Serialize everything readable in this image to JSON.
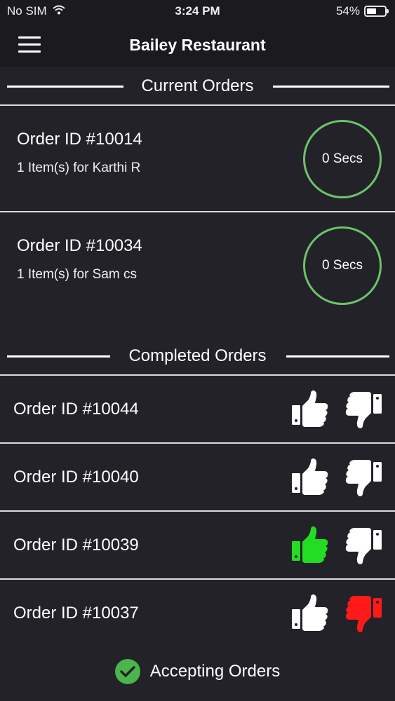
{
  "status_bar": {
    "carrier": "No SIM",
    "time": "3:24 PM",
    "battery_text": "54%",
    "battery_level": 0.54
  },
  "nav": {
    "title": "Bailey Restaurant",
    "menu_icon": "hamburger-icon"
  },
  "sections": {
    "current_title": "Current Orders",
    "completed_title": "Completed Orders"
  },
  "current_orders": [
    {
      "order_id": "Order ID #10014",
      "summary": "1 Item(s) for Karthi R",
      "timer": "0 Secs"
    },
    {
      "order_id": "Order ID #10034",
      "summary": "1 Item(s) for Sam cs",
      "timer": "0 Secs"
    }
  ],
  "completed_orders": [
    {
      "order_id": "Order ID #10044",
      "rating": "none"
    },
    {
      "order_id": "Order ID #10040",
      "rating": "none"
    },
    {
      "order_id": "Order ID #10039",
      "rating": "up"
    },
    {
      "order_id": "Order ID #10037",
      "rating": "down"
    }
  ],
  "footer": {
    "status_label": "Accepting Orders",
    "status_icon": "checkmark-circle-icon"
  },
  "colors": {
    "background": "#222228",
    "bar": "#1a1a1f",
    "timer_ring": "#6cc36b",
    "thumb_up_active": "#22dd22",
    "thumb_down_active": "#ff1a1a",
    "thumb_inactive": "#ffffff",
    "accept_check": "#4ab54a"
  }
}
